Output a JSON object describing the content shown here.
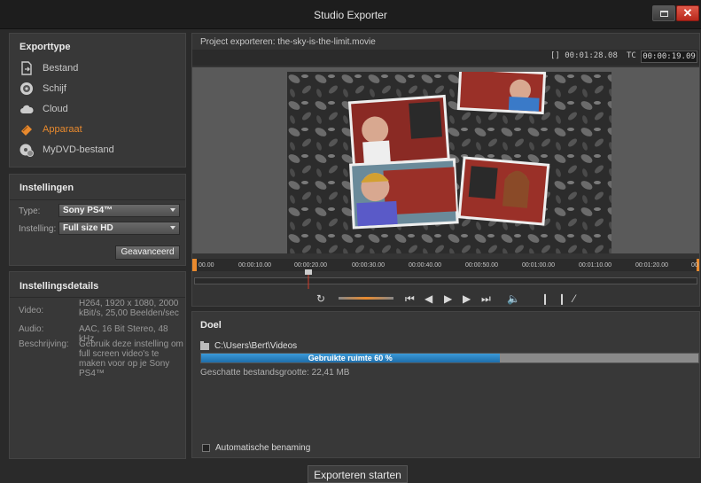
{
  "window": {
    "title": "Studio Exporter",
    "close_glyph": "✕"
  },
  "exporttype": {
    "title": "Exporttype",
    "items": [
      {
        "label": "Bestand",
        "icon": "file-export-icon"
      },
      {
        "label": "Schijf",
        "icon": "disc-icon"
      },
      {
        "label": "Cloud",
        "icon": "cloud-icon"
      },
      {
        "label": "Apparaat",
        "icon": "device-icon"
      },
      {
        "label": "MyDVD-bestand",
        "icon": "mydvd-icon"
      }
    ],
    "active": "Apparaat"
  },
  "settings": {
    "title": "Instellingen",
    "type_label": "Type:",
    "type_value": "Sony PS4™",
    "setting_label": "Instelling:",
    "setting_value": "Full size HD",
    "advanced_label": "Geavanceerd"
  },
  "details": {
    "title": "Instellingsdetails",
    "video_label": "Video:",
    "video_value": "H264, 1920 x 1080, 2000 kBit/s, 25,00 Beelden/sec",
    "audio_label": "Audio:",
    "audio_value": "AAC, 16 Bit Stereo, 48 kHz",
    "desc_label": "Beschrijving:",
    "desc_value": "Gebruik deze instelling om full screen video's te maken voor op je Sony PS4™"
  },
  "preview": {
    "project_title": "Project exporteren: the-sky-is-the-limit.movie",
    "duration": "[] 00:01:28.08",
    "tc_label": "TC",
    "tc_value": "00:00:19.09",
    "ruler_ticks": [
      "00.00",
      "00:00:10.00",
      "00:00:20.00",
      "00:00:30.00",
      "00:00:40.00",
      "00:00:50.00",
      "00:01:00.00",
      "00:01:10.00",
      "00:01:20.00",
      "00"
    ],
    "playhead_time": "00:00:19.09"
  },
  "destination": {
    "title": "Doel",
    "path": "C:\\Users\\Bert\\Videos",
    "usage_text": "Gebruikte ruimte 60 %",
    "usage_fraction": 0.6,
    "estimated_size": "Geschatte bestandsgrootte: 22,41 MB",
    "auto_naming_label": "Automatische benaming"
  },
  "footer": {
    "start_label": "Exporteren starten"
  },
  "colors": {
    "accent": "#e98a2e",
    "usage_fill": "#2a86c4",
    "background": "#2a2a2a"
  }
}
